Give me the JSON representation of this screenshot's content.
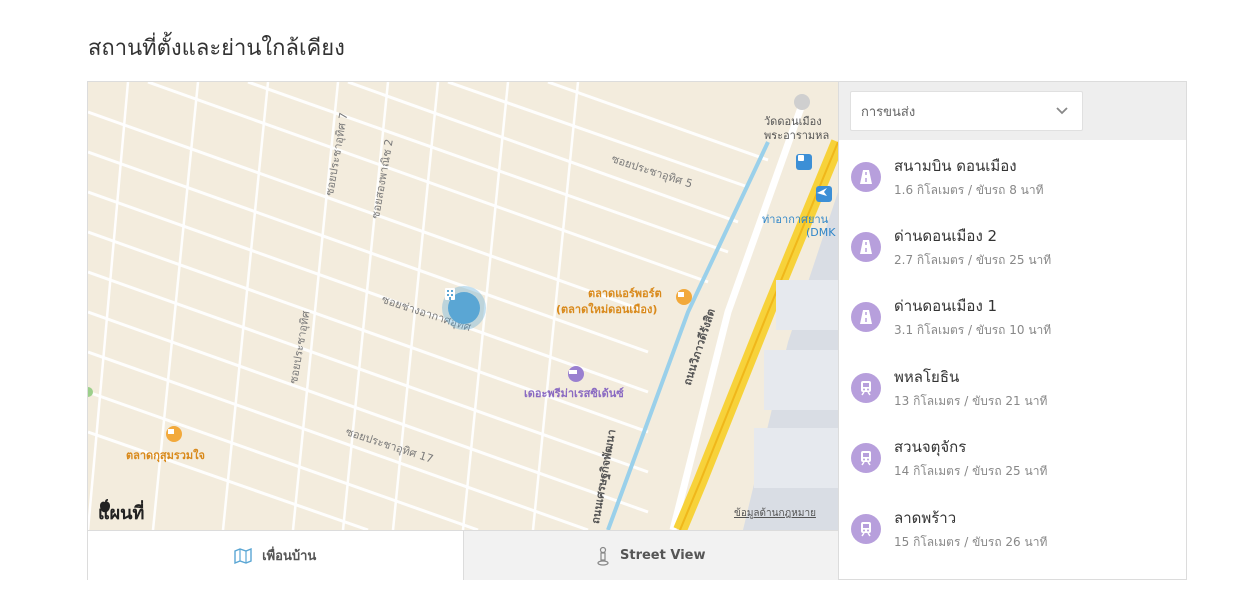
{
  "section_title": "สถานที่ตั้งและย่านใกล้เคียง",
  "map": {
    "labels": {
      "wat_line1": "วัดดอนเมือง",
      "wat_line2": "พระอารามหล",
      "soi_prachauthit_5": "ซอยประชาอุทิศ 5",
      "soi_prachauthit_7": "ซอยประชาอุทิศ 7",
      "soi_songprapa_2": "ซอยสองพาณิช 2",
      "airport_line1": "ท่าอากาศยาน",
      "airport_line2": "(DMK",
      "market_line1": "ตลาดแอร์พอร์ต",
      "market_line2": "(ตลาดใหม่ดอนเมือง)",
      "soi_changakat": "ซอยช่างอากาศอุทิศ",
      "residence": "เดอะพรีม่าเรสซิเด้นซ์",
      "soi_prachauthit_road": "ซอยประชาอุทิศ",
      "road_viphavadi": "ถนนวิภาวดีรังสิต",
      "soi_prachauthit_17": "ซอยประชาอุทิศ 17",
      "market_kusum": "ตลาดกุสุมรวมใจ",
      "road_sedthakit": "ถนนเศรษฐกิจพัฒนา"
    },
    "logo": "แผนที่",
    "legal": "ข้อมูลด้านกฎหมาย",
    "tabs": {
      "neighbors": "เพื่อนบ้าน",
      "street_view": "Street View"
    }
  },
  "panel": {
    "select_value": "การขนส่ง",
    "items": [
      {
        "name": "สนามบิน ดอนเมือง",
        "meta": "1.6 กิโลเมตร / ขับรถ 8 นาที",
        "icon": "road-icon"
      },
      {
        "name": "ด่านดอนเมือง 2",
        "meta": "2.7 กิโลเมตร / ขับรถ 25 นาที",
        "icon": "road-icon"
      },
      {
        "name": "ด่านดอนเมือง 1",
        "meta": "3.1 กิโลเมตร / ขับรถ 10 นาที",
        "icon": "road-icon"
      },
      {
        "name": "พหลโยธิน",
        "meta": "13 กิโลเมตร / ขับรถ 21 นาที",
        "icon": "train-icon"
      },
      {
        "name": "สวนจตุจักร",
        "meta": "14 กิโลเมตร / ขับรถ 25 นาที",
        "icon": "train-icon"
      },
      {
        "name": "ลาดพร้าว",
        "meta": "15 กิโลเมตร / ขับรถ 26 นาที",
        "icon": "train-icon"
      }
    ]
  },
  "colors": {
    "map_bg": "#f3ecdd",
    "highway": "#f7d23a",
    "water": "#9ad0ea",
    "transit_icon": "#b79fdc",
    "pin": "#5aa6d4"
  }
}
